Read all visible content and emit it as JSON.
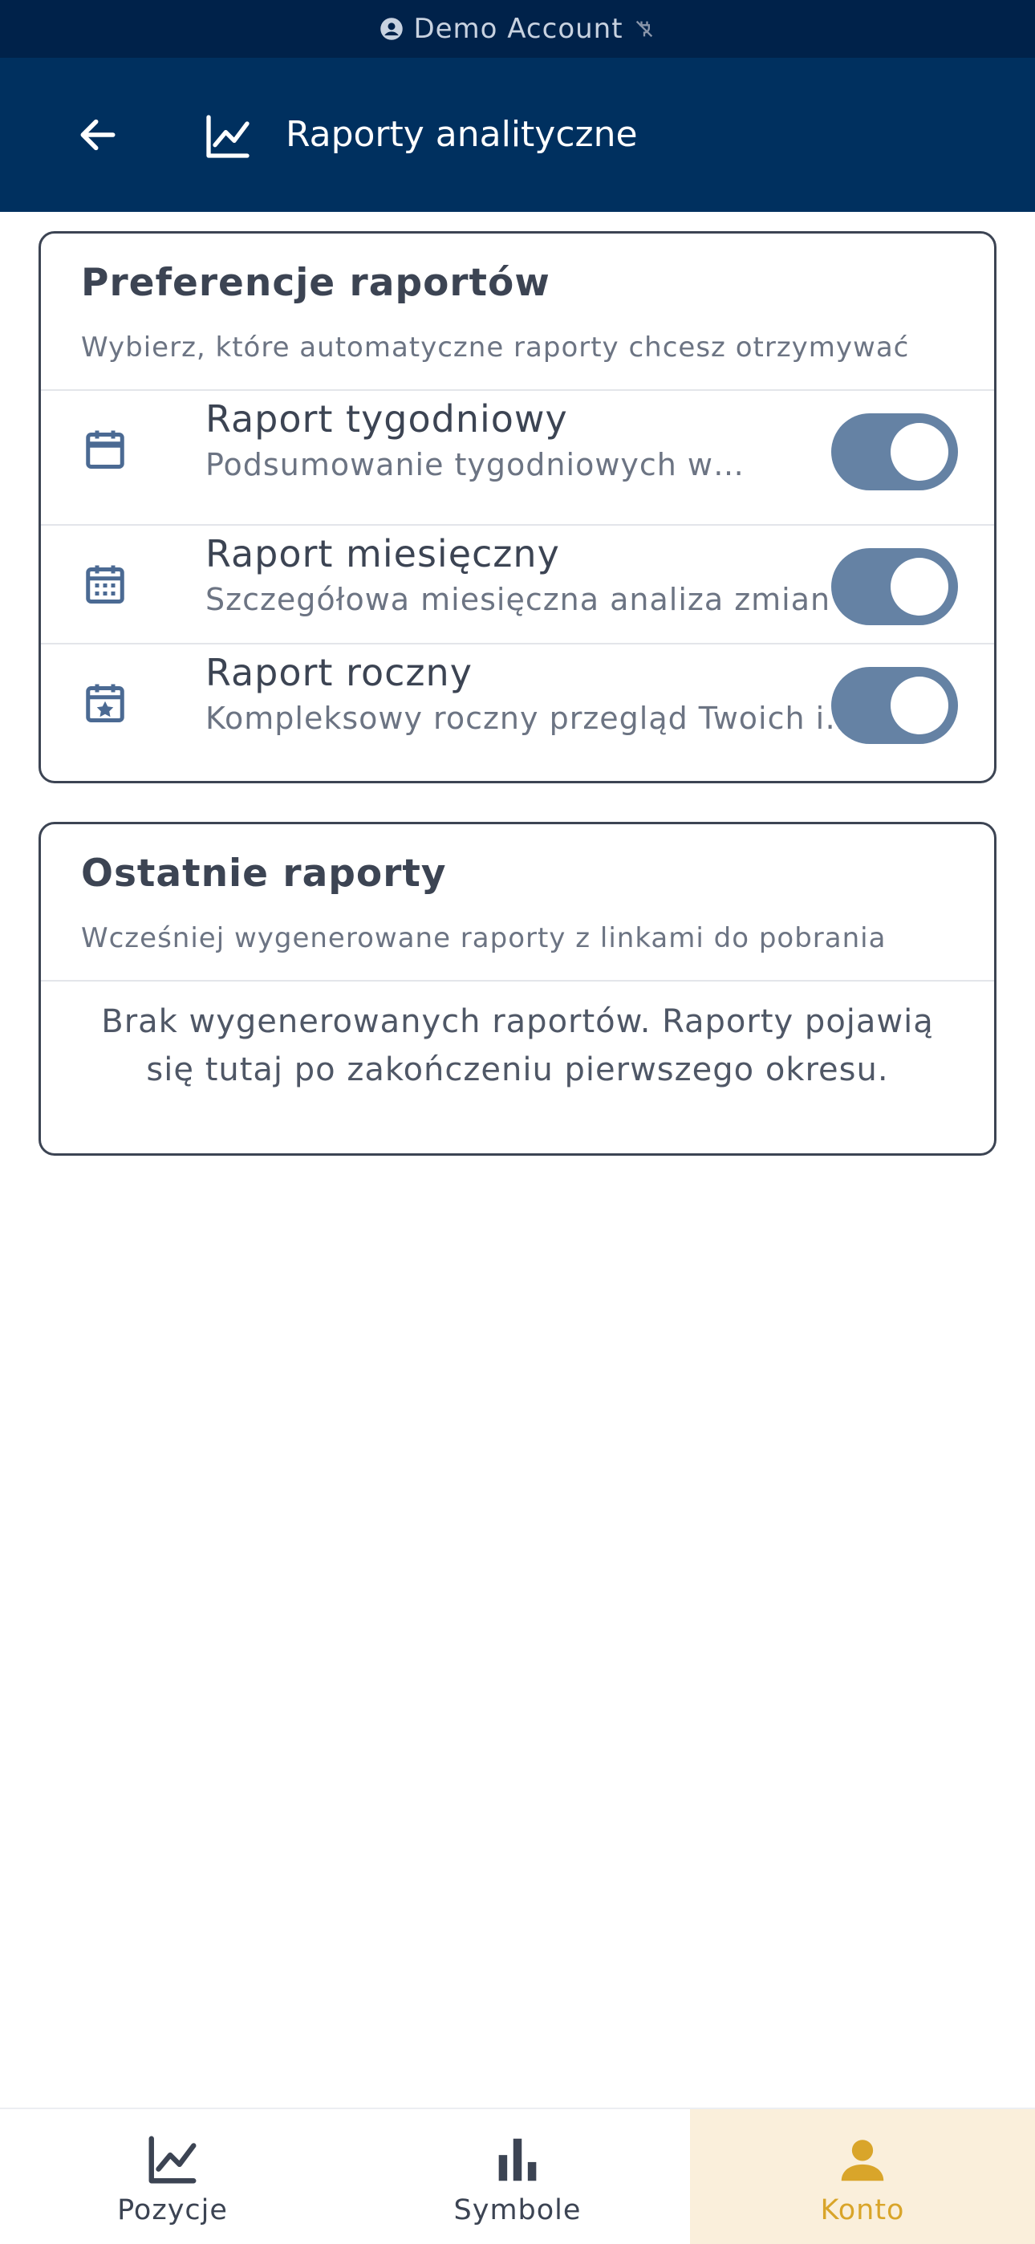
{
  "status_bar": {
    "account_label": "Demo Account",
    "icons": [
      "account-circle-icon",
      "plug-off-icon"
    ]
  },
  "app_bar": {
    "title": "Raporty analityczne",
    "back_icon": "arrow-back-icon",
    "title_icon": "line-chart-icon"
  },
  "preferences": {
    "title": "Preferencje raportów",
    "subtitle": "Wybierz, które automatyczne raporty chcesz otrzymywać",
    "items": [
      {
        "title": "Raport tygodniowy",
        "description": "Podsumowanie tygodniowych wyników",
        "icon": "calendar-week-icon",
        "enabled": true
      },
      {
        "title": "Raport miesięczny",
        "description": "Szczegółowa miesięczna analiza zmian",
        "icon": "calendar-month-icon",
        "enabled": true
      },
      {
        "title": "Raport roczny",
        "description": "Kompleksowy roczny przegląd Twoich inwestycji",
        "icon": "calendar-star-icon",
        "enabled": true
      }
    ]
  },
  "recent": {
    "title": "Ostatnie raporty",
    "subtitle": "Wcześniej wygenerowane raporty z linkami do pobrania",
    "empty_message": "Brak wygenerowanych raportów. Raporty pojawią się tutaj po zakończeniu pierwszego okresu."
  },
  "bottom_nav": {
    "items": [
      {
        "label": "Pozycje",
        "icon": "line-chart-icon",
        "active": false
      },
      {
        "label": "Symbole",
        "icon": "bar-chart-icon",
        "active": false
      },
      {
        "label": "Konto",
        "icon": "person-icon",
        "active": true
      }
    ]
  },
  "colors": {
    "primary_dark": "#00305f",
    "status_bar": "#00224a",
    "toggle_on": "#6582a4",
    "accent": "#d9a52a",
    "active_tab_bg": "#faefdb"
  }
}
